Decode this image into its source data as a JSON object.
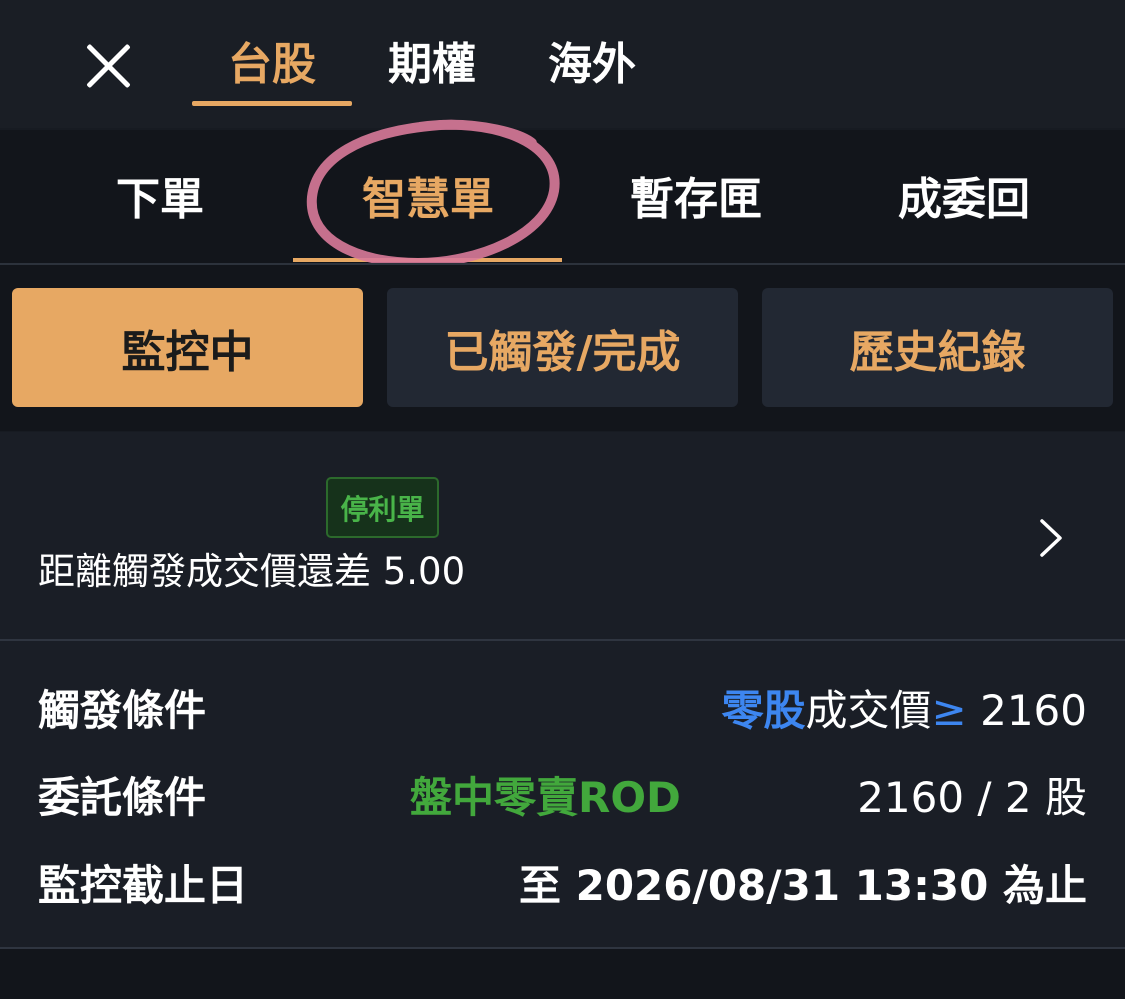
{
  "market_tabs": [
    {
      "label": "台股",
      "active": true
    },
    {
      "label": "期權",
      "active": false
    },
    {
      "label": "海外",
      "active": false
    }
  ],
  "order_tabs": [
    {
      "label": "下單",
      "active": false
    },
    {
      "label": "智慧單",
      "active": true
    },
    {
      "label": "暫存匣",
      "active": false
    },
    {
      "label": "成委回",
      "active": false
    }
  ],
  "filters": [
    {
      "label": "監控中",
      "active": true
    },
    {
      "label": "已觸發/完成",
      "active": false
    },
    {
      "label": "歷史紀錄",
      "active": false
    }
  ],
  "order": {
    "tag": "停利單",
    "distance_text": "距離觸發成交價還差 5.00",
    "trigger_label": "觸發條件",
    "trigger_prefix": "零股",
    "trigger_text": "成交價",
    "trigger_op": "≥",
    "trigger_value": " 2160",
    "entrust_label": "委託條件",
    "entrust_type": "盤中零賣ROD",
    "entrust_value": "2160 / 2 股",
    "deadline_label": "監控截止日",
    "deadline_value": "至 2026/08/31 13:30 為止"
  },
  "colors": {
    "accent": "#e7a863",
    "background": "#171b22",
    "green": "#42a83c",
    "blue": "#3d86f0",
    "annotation": "#d97a9a"
  },
  "icons": {
    "close": "close-icon",
    "chevron": "chevron-right-icon"
  }
}
